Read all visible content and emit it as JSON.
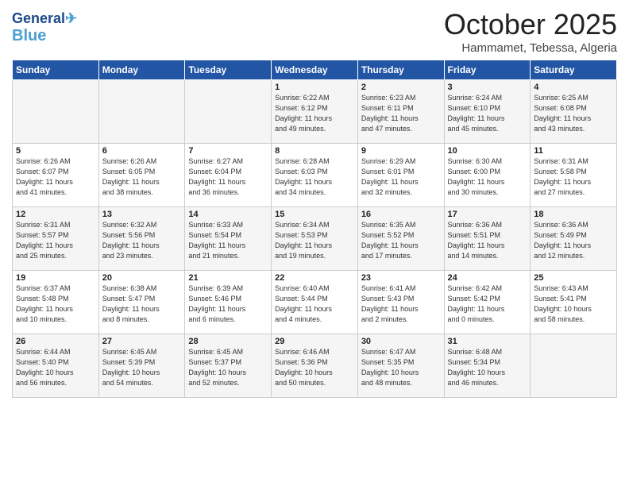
{
  "logo": {
    "line1": "General",
    "line2": "Blue"
  },
  "title": "October 2025",
  "location": "Hammamet, Tebessa, Algeria",
  "weekdays": [
    "Sunday",
    "Monday",
    "Tuesday",
    "Wednesday",
    "Thursday",
    "Friday",
    "Saturday"
  ],
  "weeks": [
    [
      {
        "day": "",
        "info": ""
      },
      {
        "day": "",
        "info": ""
      },
      {
        "day": "",
        "info": ""
      },
      {
        "day": "1",
        "info": "Sunrise: 6:22 AM\nSunset: 6:12 PM\nDaylight: 11 hours\nand 49 minutes."
      },
      {
        "day": "2",
        "info": "Sunrise: 6:23 AM\nSunset: 6:11 PM\nDaylight: 11 hours\nand 47 minutes."
      },
      {
        "day": "3",
        "info": "Sunrise: 6:24 AM\nSunset: 6:10 PM\nDaylight: 11 hours\nand 45 minutes."
      },
      {
        "day": "4",
        "info": "Sunrise: 6:25 AM\nSunset: 6:08 PM\nDaylight: 11 hours\nand 43 minutes."
      }
    ],
    [
      {
        "day": "5",
        "info": "Sunrise: 6:26 AM\nSunset: 6:07 PM\nDaylight: 11 hours\nand 41 minutes."
      },
      {
        "day": "6",
        "info": "Sunrise: 6:26 AM\nSunset: 6:05 PM\nDaylight: 11 hours\nand 38 minutes."
      },
      {
        "day": "7",
        "info": "Sunrise: 6:27 AM\nSunset: 6:04 PM\nDaylight: 11 hours\nand 36 minutes."
      },
      {
        "day": "8",
        "info": "Sunrise: 6:28 AM\nSunset: 6:03 PM\nDaylight: 11 hours\nand 34 minutes."
      },
      {
        "day": "9",
        "info": "Sunrise: 6:29 AM\nSunset: 6:01 PM\nDaylight: 11 hours\nand 32 minutes."
      },
      {
        "day": "10",
        "info": "Sunrise: 6:30 AM\nSunset: 6:00 PM\nDaylight: 11 hours\nand 30 minutes."
      },
      {
        "day": "11",
        "info": "Sunrise: 6:31 AM\nSunset: 5:58 PM\nDaylight: 11 hours\nand 27 minutes."
      }
    ],
    [
      {
        "day": "12",
        "info": "Sunrise: 6:31 AM\nSunset: 5:57 PM\nDaylight: 11 hours\nand 25 minutes."
      },
      {
        "day": "13",
        "info": "Sunrise: 6:32 AM\nSunset: 5:56 PM\nDaylight: 11 hours\nand 23 minutes."
      },
      {
        "day": "14",
        "info": "Sunrise: 6:33 AM\nSunset: 5:54 PM\nDaylight: 11 hours\nand 21 minutes."
      },
      {
        "day": "15",
        "info": "Sunrise: 6:34 AM\nSunset: 5:53 PM\nDaylight: 11 hours\nand 19 minutes."
      },
      {
        "day": "16",
        "info": "Sunrise: 6:35 AM\nSunset: 5:52 PM\nDaylight: 11 hours\nand 17 minutes."
      },
      {
        "day": "17",
        "info": "Sunrise: 6:36 AM\nSunset: 5:51 PM\nDaylight: 11 hours\nand 14 minutes."
      },
      {
        "day": "18",
        "info": "Sunrise: 6:36 AM\nSunset: 5:49 PM\nDaylight: 11 hours\nand 12 minutes."
      }
    ],
    [
      {
        "day": "19",
        "info": "Sunrise: 6:37 AM\nSunset: 5:48 PM\nDaylight: 11 hours\nand 10 minutes."
      },
      {
        "day": "20",
        "info": "Sunrise: 6:38 AM\nSunset: 5:47 PM\nDaylight: 11 hours\nand 8 minutes."
      },
      {
        "day": "21",
        "info": "Sunrise: 6:39 AM\nSunset: 5:46 PM\nDaylight: 11 hours\nand 6 minutes."
      },
      {
        "day": "22",
        "info": "Sunrise: 6:40 AM\nSunset: 5:44 PM\nDaylight: 11 hours\nand 4 minutes."
      },
      {
        "day": "23",
        "info": "Sunrise: 6:41 AM\nSunset: 5:43 PM\nDaylight: 11 hours\nand 2 minutes."
      },
      {
        "day": "24",
        "info": "Sunrise: 6:42 AM\nSunset: 5:42 PM\nDaylight: 11 hours\nand 0 minutes."
      },
      {
        "day": "25",
        "info": "Sunrise: 6:43 AM\nSunset: 5:41 PM\nDaylight: 10 hours\nand 58 minutes."
      }
    ],
    [
      {
        "day": "26",
        "info": "Sunrise: 6:44 AM\nSunset: 5:40 PM\nDaylight: 10 hours\nand 56 minutes."
      },
      {
        "day": "27",
        "info": "Sunrise: 6:45 AM\nSunset: 5:39 PM\nDaylight: 10 hours\nand 54 minutes."
      },
      {
        "day": "28",
        "info": "Sunrise: 6:45 AM\nSunset: 5:37 PM\nDaylight: 10 hours\nand 52 minutes."
      },
      {
        "day": "29",
        "info": "Sunrise: 6:46 AM\nSunset: 5:36 PM\nDaylight: 10 hours\nand 50 minutes."
      },
      {
        "day": "30",
        "info": "Sunrise: 6:47 AM\nSunset: 5:35 PM\nDaylight: 10 hours\nand 48 minutes."
      },
      {
        "day": "31",
        "info": "Sunrise: 6:48 AM\nSunset: 5:34 PM\nDaylight: 10 hours\nand 46 minutes."
      },
      {
        "day": "",
        "info": ""
      }
    ]
  ]
}
